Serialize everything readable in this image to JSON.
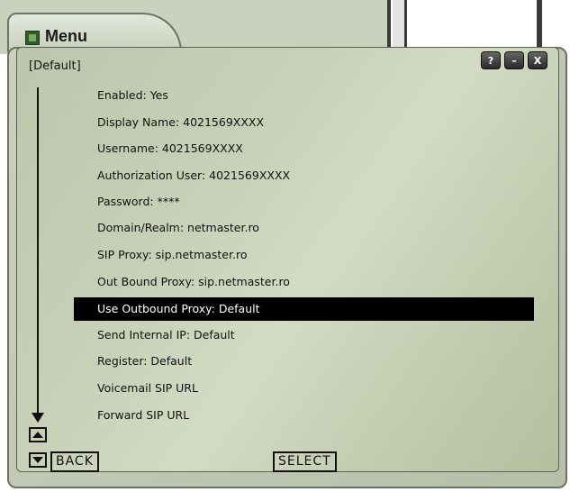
{
  "window": {
    "title": "Menu",
    "icon": "app-icon"
  },
  "screen": {
    "title": "[Default]",
    "buttons": [
      {
        "label": "?",
        "icon": "help-icon"
      },
      {
        "label": "–",
        "icon": "minimize-icon"
      },
      {
        "label": "X",
        "icon": "close-icon"
      }
    ]
  },
  "menu": {
    "items": [
      {
        "label": "Enabled: Yes"
      },
      {
        "label": "Display Name: 4021569XXXX"
      },
      {
        "label": "Username: 4021569XXXX"
      },
      {
        "label": "Authorization User: 4021569XXXX"
      },
      {
        "label": "Password: ****"
      },
      {
        "label": "Domain/Realm: netmaster.ro"
      },
      {
        "label": "SIP Proxy: sip.netmaster.ro"
      },
      {
        "label": "Out Bound Proxy: sip.netmaster.ro"
      },
      {
        "label": "Use Outbound Proxy: Default"
      },
      {
        "label": "Send Internal IP: Default"
      },
      {
        "label": "Register: Default"
      },
      {
        "label": "Voicemail SIP URL"
      },
      {
        "label": "Forward SIP URL"
      }
    ],
    "selected_index": 8
  },
  "softkeys": {
    "back": "BACK",
    "select": "SELECT"
  },
  "colors": {
    "screen_bg": "#c8d0b8",
    "selection_bg": "#000000",
    "selection_text": "#ffffff"
  }
}
